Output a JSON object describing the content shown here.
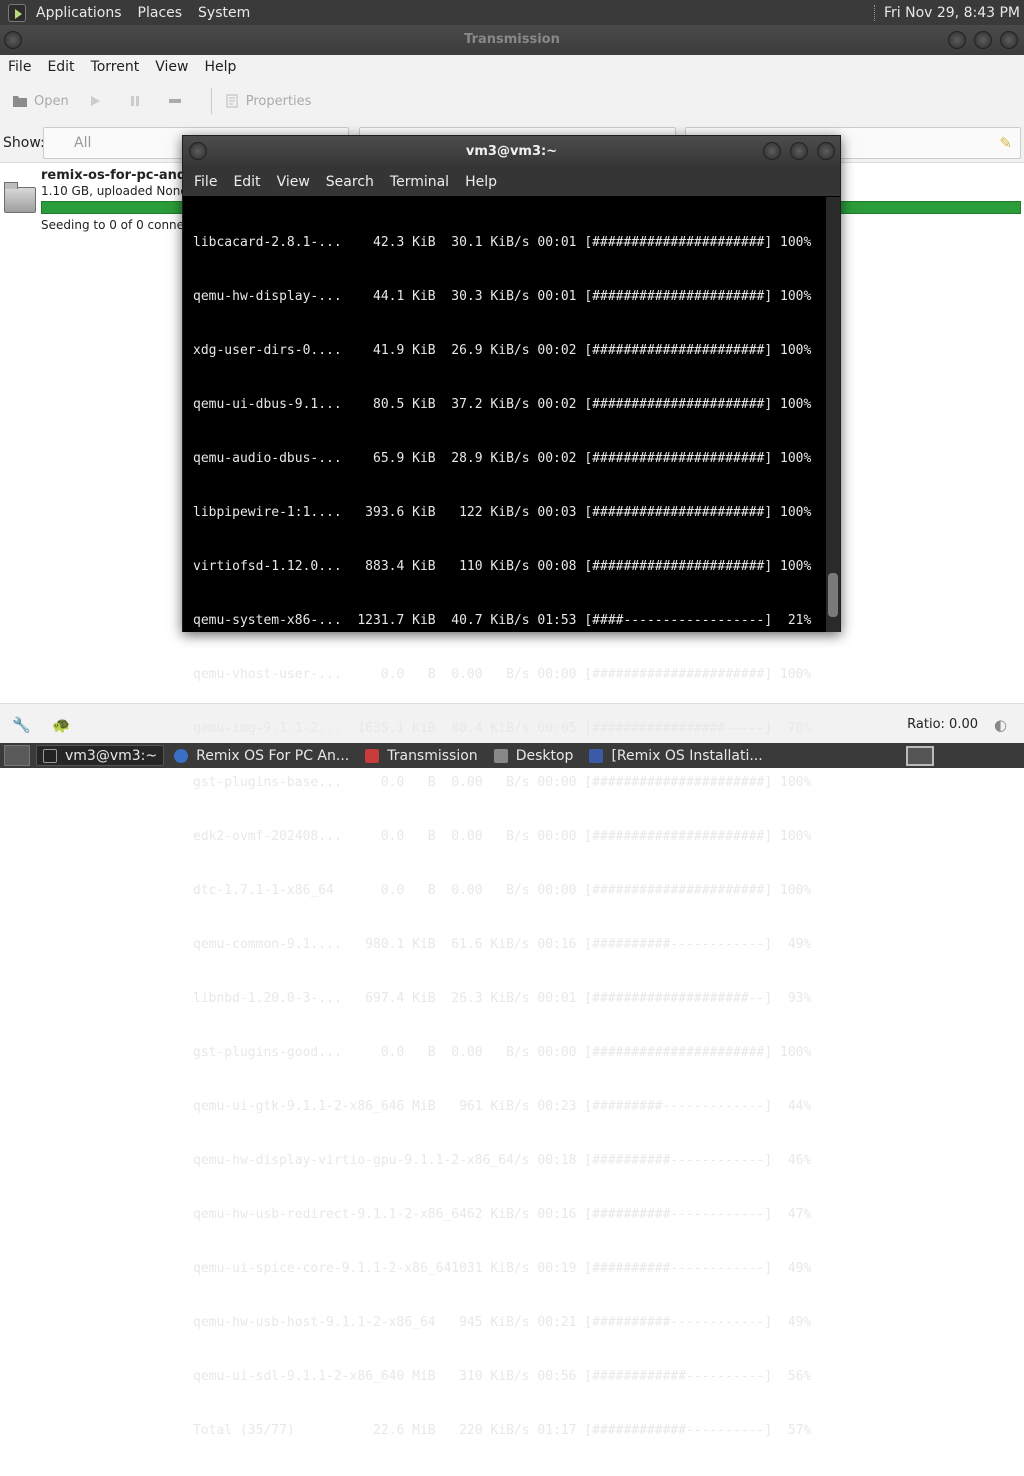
{
  "top_panel": {
    "menus": [
      "Applications",
      "Places",
      "System"
    ],
    "clock": "Fri Nov 29,  8:43 PM"
  },
  "transmission": {
    "title": "Transmission",
    "menus": [
      "File",
      "Edit",
      "Torrent",
      "View",
      "Help"
    ],
    "toolbar": {
      "open": "Open",
      "properties": "Properties"
    },
    "filter": {
      "show_label": "Show:",
      "category": "All"
    },
    "torrent": {
      "name": "remix-os-for-pc-andro",
      "info": "1.10 GB, uploaded None (R",
      "status": "Seeding to 0 of 0 connecte"
    },
    "statusbar": {
      "ratio": "Ratio: 0.00"
    }
  },
  "terminal": {
    "title": "vm3@vm3:~",
    "menus": [
      "File",
      "Edit",
      "View",
      "Search",
      "Terminal",
      "Help"
    ],
    "lines": [
      "libcacard-2.8.1-...    42.3 KiB  30.1 KiB/s 00:01 [######################] 100%",
      "qemu-hw-display-...    44.1 KiB  30.3 KiB/s 00:01 [######################] 100%",
      "xdg-user-dirs-0....    41.9 KiB  26.9 KiB/s 00:02 [######################] 100%",
      "qemu-ui-dbus-9.1...    80.5 KiB  37.2 KiB/s 00:02 [######################] 100%",
      "qemu-audio-dbus-...    65.9 KiB  28.9 KiB/s 00:02 [######################] 100%",
      "libpipewire-1:1....   393.6 KiB   122 KiB/s 00:03 [######################] 100%",
      "virtiofsd-1.12.0...   883.4 KiB   110 KiB/s 00:08 [######################] 100%",
      "qemu-system-x86-...  1231.7 KiB  40.7 KiB/s 01:53 [####------------------]  21%",
      "qemu-vhost-user-...     0.0   B  0.00   B/s 00:00 [######################] 100%",
      "qemu-img-9.1.1-2...  1635.1 KiB  88.4 KiB/s 00:05 [#################-----]  78%",
      "gst-plugins-base...     0.0   B  0.00   B/s 00:00 [######################] 100%",
      "edk2-ovmf-202408...     0.0   B  0.00   B/s 00:00 [######################] 100%",
      "dtc-1.7.1-1-x86_64      0.0   B  0.00   B/s 00:00 [######################] 100%",
      "qemu-common-9.1....   980.1 KiB  61.6 KiB/s 00:16 [##########------------]  49%",
      "libnbd-1.20.0-3-...   697.4 KiB  26.3 KiB/s 00:01 [####################--]  93%",
      "gst-plugins-good...     0.0   B  0.00   B/s 00:00 [######################] 100%",
      "qemu-ui-gtk-9.1.1-2-x86_646 MiB   961 KiB/s 00:23 [#########-------------]  44%",
      "qemu-hw-display-virtio-gpu-9.1.1-2-x86_64/s 00:18 [##########------------]  46%",
      "qemu-hw-usb-redirect-9.1.1-2-x86_6462 KiB/s 00:16 [##########------------]  47%",
      "qemu-ui-spice-core-9.1.1-2-x86_641031 KiB/s 00:19 [##########------------]  49%",
      "qemu-hw-usb-host-9.1.1-2-x86_64   945 KiB/s 00:21 [##########------------]  49%",
      "qemu-ui-sdl-9.1.1-2-x86_640 MiB   310 KiB/s 00:56 [############----------]  56%",
      "Total (35/77)          22.6 MiB   220 KiB/s 01:17 [############----------]  57%"
    ]
  },
  "taskbar": {
    "tasks": [
      "vm3@vm3:~",
      "Remix OS For PC An...",
      "Transmission",
      "Desktop",
      "[Remix OS Installati..."
    ]
  },
  "colors": {
    "progress_green": "#2a9c3a",
    "panel": "#3a3a3a"
  }
}
